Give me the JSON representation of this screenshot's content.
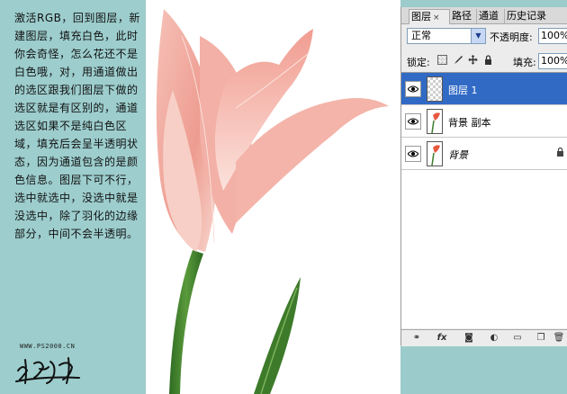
{
  "tutorial": {
    "text": "激活RGB，回到图层，新建图层，填充白色，此时你会奇怪，怎么花还不是白色哦，对，用通道做出的选区跟我们图层下做的选区就是有区别的，通道选区如果不是纯白色区域，填充后会呈半透明状态，因为通道包含的是颜色信息。图层下可不行，选中就选中，没选中就是没选中，除了羽化的边缘部分，中间不会半透明。",
    "site": "WWW.PS2000.CN",
    "signature": "张明月"
  },
  "panel": {
    "tabs": [
      {
        "label": "图层",
        "active": true
      },
      {
        "label": "路径",
        "active": false
      },
      {
        "label": "通道",
        "active": false
      },
      {
        "label": "历史记录",
        "active": false
      }
    ],
    "tab_close": "×",
    "blend_mode": "正常",
    "blend_arrow": "▼",
    "opacity_label": "不透明度:",
    "opacity_value": "100%",
    "lock_label": "锁定:",
    "lock_icons": [
      "transparency-lock-icon",
      "brush-lock-icon",
      "move-lock-icon",
      "padlock-icon"
    ],
    "fill_label": "填充:",
    "fill_value": "100%",
    "layers": [
      {
        "name": "图层 1",
        "selected": true,
        "locked": false,
        "italic": false
      },
      {
        "name": "背景 副本",
        "selected": false,
        "locked": false,
        "italic": false
      },
      {
        "name": "背景",
        "selected": false,
        "locked": true,
        "italic": true
      }
    ],
    "lock_glyph": "🔒",
    "bottom_icons": [
      "link-icon",
      "fx-icon",
      "mask-icon",
      "adjustment-icon",
      "folder-icon",
      "new-layer-icon",
      "trash-icon"
    ],
    "bottom_glyphs": {
      "link": "⚭",
      "fx": "fx",
      "mask": "◙",
      "adjustment": "◐",
      "folder": "▭",
      "new": "❐",
      "trash": "🗑"
    }
  },
  "colors": {
    "teal": "#9dcdcd",
    "selection": "#316ac5",
    "petal": "#f2a8a0",
    "stem": "#3c7d2e"
  }
}
